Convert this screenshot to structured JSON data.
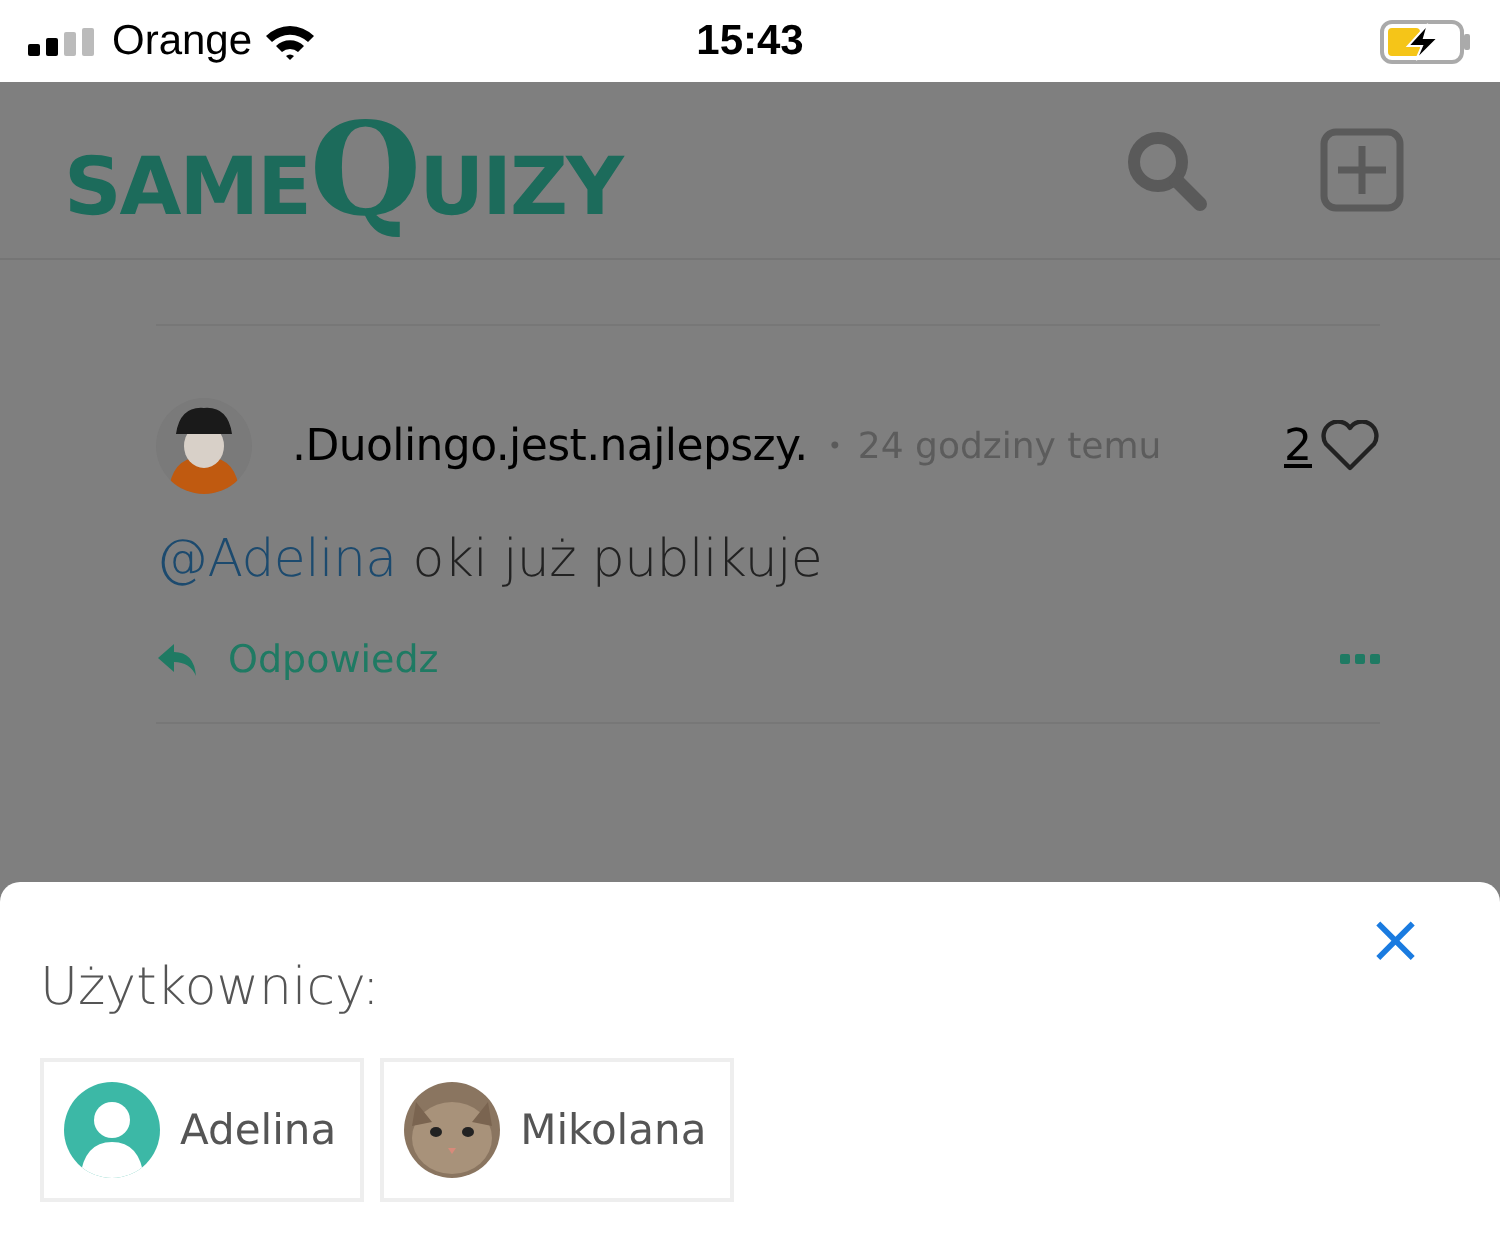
{
  "status_bar": {
    "carrier": "Orange",
    "time": "15:43"
  },
  "header": {
    "logo_left": "SAME",
    "logo_right": "QUIZY"
  },
  "comment": {
    "author": ".Duolingo.jest.najlepszy.",
    "separator": "•",
    "time": "24 godziny temu",
    "likes": "2",
    "mention": "@Adelina",
    "text": " oki już publikuje",
    "reply": "Odpowiedz"
  },
  "sheet": {
    "title": "Użytkownicy:",
    "close": "×",
    "users": [
      {
        "name": "Adelina",
        "kind": "default"
      },
      {
        "name": "Mikolana",
        "kind": "picture"
      }
    ]
  }
}
